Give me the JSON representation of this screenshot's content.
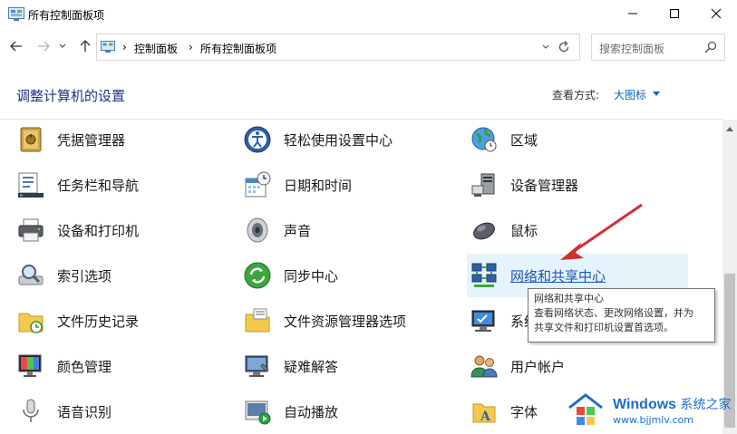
{
  "window": {
    "title": "所有控制面板项"
  },
  "address": {
    "crumbs": [
      "控制面板",
      "所有控制面板项"
    ],
    "separator": "›"
  },
  "search": {
    "placeholder": "搜索控制面板"
  },
  "header": {
    "title": "调整计算机的设置",
    "view_by_label": "查看方式:",
    "view_by_value": "大图标"
  },
  "items": {
    "col1": [
      "凭据管理器",
      "任务栏和导航",
      "设备和打印机",
      "索引选项",
      "文件历史记录",
      "颜色管理",
      "语音识别"
    ],
    "col2": [
      "轻松使用设置中心",
      "日期和时间",
      "声音",
      "同步中心",
      "文件资源管理器选项",
      "疑难解答",
      "自动播放"
    ],
    "col3": [
      "区域",
      "设备管理器",
      "鼠标",
      "网络和共享中心",
      "系统",
      "用户帐户",
      "字体"
    ]
  },
  "tooltip": {
    "title": "网络和共享中心",
    "line1": "查看网络状态、更改网络设置，并为",
    "line2": "共享文件和打印机设置首选项。"
  },
  "watermark": {
    "brand": "Windows",
    "brand_cn": "系统之家",
    "url": "www.bjjmlv.com"
  },
  "colors": {
    "accent": "#0066cc",
    "hover_bg": "#e5f3fb",
    "arrow": "#d32f2f"
  }
}
